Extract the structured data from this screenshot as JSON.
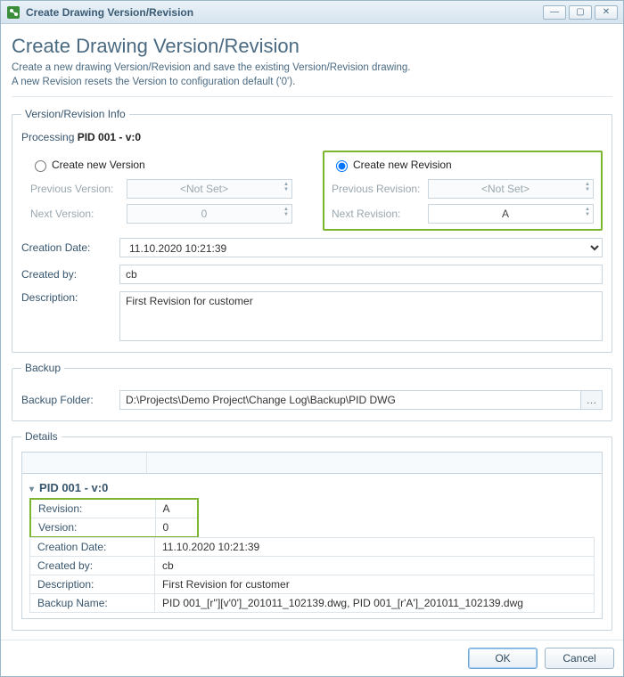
{
  "window": {
    "title": "Create Drawing Version/Revision"
  },
  "header": {
    "title": "Create Drawing Version/Revision",
    "desc1": "Create a new drawing Version/Revision and save the existing Version/Revision drawing.",
    "desc2": "A new Revision resets the Version to configuration default ('0')."
  },
  "info": {
    "legend": "Version/Revision Info",
    "processing_label": "Processing ",
    "processing_value": "PID 001 - v:0",
    "version": {
      "radio": "Create new Version",
      "prev_label": "Previous Version:",
      "prev_value": "<Not Set>",
      "next_label": "Next Version:",
      "next_value": "0"
    },
    "revision": {
      "radio": "Create new Revision",
      "prev_label": "Previous Revision:",
      "prev_value": "<Not Set>",
      "next_label": "Next Revision:",
      "next_value": "A"
    },
    "creation_date_label": "Creation Date:",
    "creation_date_value": "11.10.2020 10:21:39",
    "created_by_label": "Created by:",
    "created_by_value": "cb",
    "description_label": "Description:",
    "description_value": "First Revision for customer"
  },
  "backup": {
    "legend": "Backup",
    "folder_label": "Backup Folder:",
    "folder_value": "D:\\Projects\\Demo Project\\Change Log\\Backup\\PID DWG"
  },
  "details": {
    "legend": "Details",
    "heading": "PID 001 - v:0",
    "rows": {
      "revision_k": "Revision:",
      "revision_v": "A",
      "version_k": "Version:",
      "version_v": "0",
      "cdate_k": "Creation Date:",
      "cdate_v": "11.10.2020 10:21:39",
      "cby_k": "Created by:",
      "cby_v": "cb",
      "desc_k": "Description:",
      "desc_v": "First Revision for customer",
      "bname_k": "Backup Name:",
      "bname_v": "PID 001_[r''][v'0']_201011_102139.dwg, PID 001_[r'A']_201011_102139.dwg"
    }
  },
  "footer": {
    "ok": "OK",
    "cancel": "Cancel"
  }
}
